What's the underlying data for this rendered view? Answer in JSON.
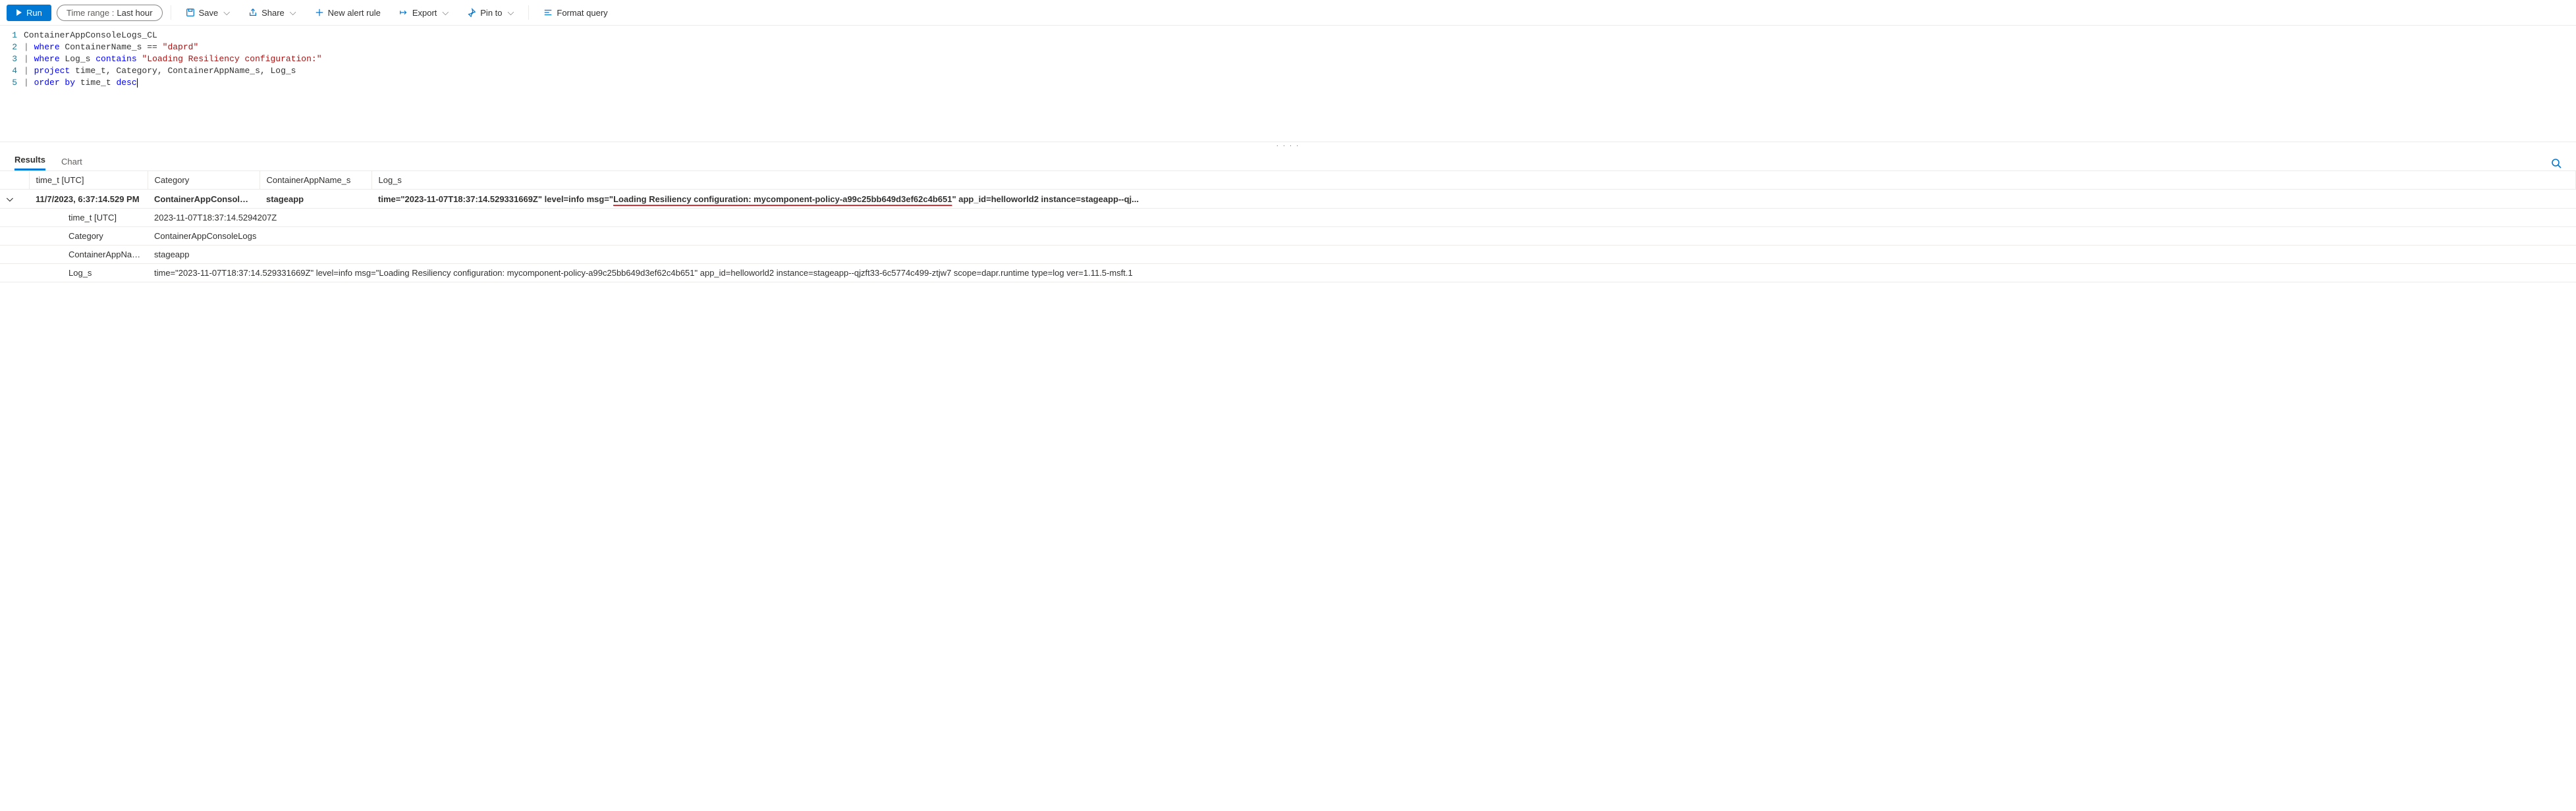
{
  "toolbar": {
    "run": "Run",
    "time_label": "Time range :",
    "time_value": "Last hour",
    "save": "Save",
    "share": "Share",
    "new_alert": "New alert rule",
    "export": "Export",
    "pin": "Pin to",
    "format": "Format query"
  },
  "editor": {
    "lines": [
      {
        "n": 1,
        "tokens": [
          [
            "id",
            "ContainerAppConsoleLogs_CL"
          ]
        ]
      },
      {
        "n": 2,
        "tokens": [
          [
            "pipe",
            "| "
          ],
          [
            "kw",
            "where"
          ],
          [
            "id",
            " ContainerName_s == "
          ],
          [
            "str",
            "\"daprd\""
          ]
        ]
      },
      {
        "n": 3,
        "tokens": [
          [
            "pipe",
            "| "
          ],
          [
            "kw",
            "where"
          ],
          [
            "id",
            " Log_s "
          ],
          [
            "kw",
            "contains"
          ],
          [
            "id",
            " "
          ],
          [
            "str",
            "\"Loading Resiliency configuration:\""
          ]
        ]
      },
      {
        "n": 4,
        "tokens": [
          [
            "pipe",
            "| "
          ],
          [
            "kw",
            "project"
          ],
          [
            "id",
            " time_t, Category, ContainerAppName_s, Log_s"
          ]
        ]
      },
      {
        "n": 5,
        "tokens": [
          [
            "pipe",
            "| "
          ],
          [
            "kw",
            "order by"
          ],
          [
            "id",
            " time_t "
          ],
          [
            "kw",
            "desc"
          ]
        ]
      }
    ]
  },
  "tabs": {
    "results": "Results",
    "chart": "Chart"
  },
  "columns": {
    "time": "time_t [UTC]",
    "category": "Category",
    "name": "ContainerAppName_s",
    "log": "Log_s"
  },
  "row": {
    "time_local": "11/7/2023, 6:37:14.529 PM",
    "category": "ContainerAppConsoleLogs",
    "name": "stageapp",
    "log_pre": "time=\"2023-11-07T18:37:14.529331669Z\" level=info msg=\"",
    "log_underlined": "Loading Resiliency configuration: mycomponent-policy-a99c25bb649d3ef62c4b651",
    "log_post": "\" app_id=helloworld2 instance=stageapp--qj...",
    "details": {
      "time_label": "time_t [UTC]",
      "time_value": "2023-11-07T18:37:14.5294207Z",
      "category_label": "Category",
      "category_value": "ContainerAppConsoleLogs",
      "name_label": "ContainerAppName_s",
      "name_value": "stageapp",
      "log_label": "Log_s",
      "log_value": "time=\"2023-11-07T18:37:14.529331669Z\" level=info msg=\"Loading Resiliency configuration: mycomponent-policy-a99c25bb649d3ef62c4b651\" app_id=helloworld2 instance=stageapp--qjzft33-6c5774c499-ztjw7 scope=dapr.runtime type=log ver=1.11.5-msft.1"
    }
  }
}
